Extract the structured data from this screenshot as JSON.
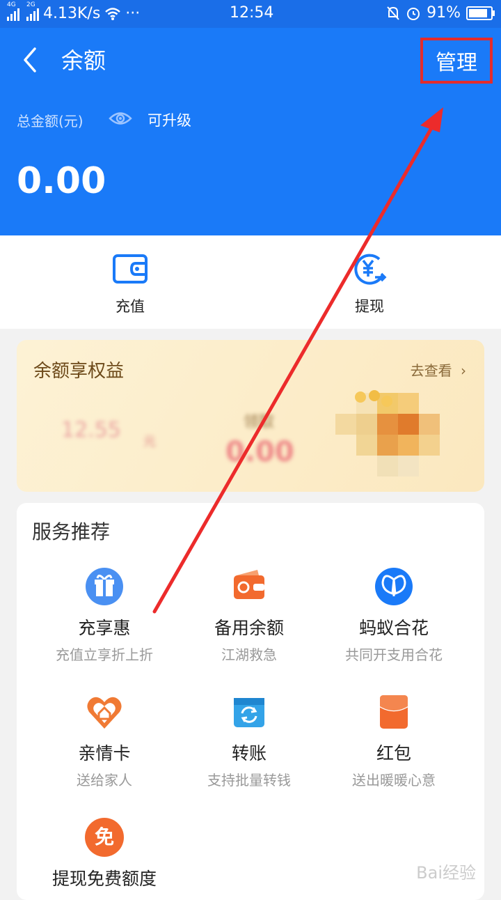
{
  "status_bar": {
    "network_left": "4G",
    "network_right": "2G",
    "speed": "4.13K/s",
    "dots": "···",
    "time": "12:54",
    "battery": "91%"
  },
  "header": {
    "title": "余额",
    "manage_label": "管理",
    "total_label": "总金额(元)",
    "upgrade_label": "可升级",
    "amount": "0.00"
  },
  "actions": [
    {
      "label": "充值",
      "icon": "wallet-icon"
    },
    {
      "label": "提现",
      "icon": "yuan-withdraw-icon"
    }
  ],
  "benefits": {
    "title": "余额享权益",
    "link": "去查看",
    "left_caption": "12.55",
    "left_unit": "元",
    "right_caption": "领取",
    "right_value": "0.00"
  },
  "services": {
    "title": "服务推荐",
    "items": [
      {
        "name": "充享惠",
        "desc": "充值立享折上折",
        "icon": "gift-icon"
      },
      {
        "name": "备用余额",
        "desc": "江湖救急",
        "icon": "backup-wallet-icon"
      },
      {
        "name": "蚂蚁合花",
        "desc": "共同开支用合花",
        "icon": "butterfly-icon"
      },
      {
        "name": "亲情卡",
        "desc": "送给家人",
        "icon": "heart-home-icon"
      },
      {
        "name": "转账",
        "desc": "支持批量转钱",
        "icon": "transfer-icon"
      },
      {
        "name": "红包",
        "desc": "送出暖暖心意",
        "icon": "red-envelope-icon"
      },
      {
        "name": "提现免费额度",
        "desc": "",
        "icon": "free-badge-icon",
        "badge": "免"
      }
    ]
  },
  "colors": {
    "header_blue": "#1a7af8",
    "highlight_red": "#e32c2c"
  },
  "watermark": "Bai经验"
}
